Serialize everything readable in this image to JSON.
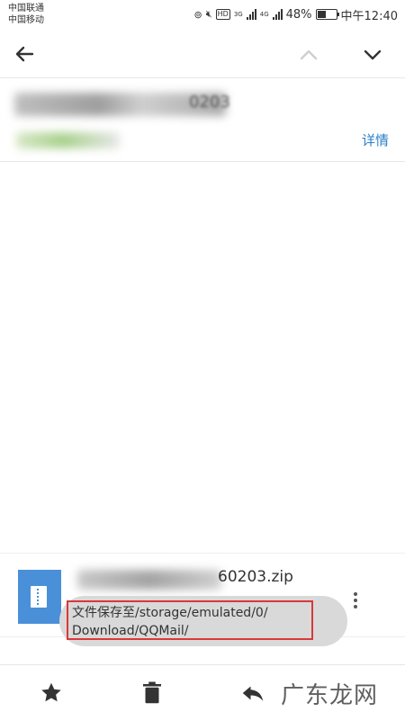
{
  "status_bar": {
    "carrier_1": "中国联通",
    "carrier_2": "中国移动",
    "hd_label": "HD",
    "net_1": "3G",
    "net_2": "4G",
    "battery": "48%",
    "battery_level": 0.48,
    "time": "中午12:40"
  },
  "mail": {
    "subject_tail": "0203",
    "details_link": "详情"
  },
  "attachment": {
    "filename_visible": "60203.zip",
    "icon": "zip-file-icon"
  },
  "toast": {
    "line1": "文件保存至/storage/emulated/0/",
    "line2": "Download/QQMail/"
  },
  "toolbar": {
    "star": "star-icon",
    "delete": "trash-icon",
    "reply": "reply-icon"
  },
  "watermark": "广东龙网",
  "colors": {
    "link": "#2a7fc7",
    "attachment_icon": "#4a90d9",
    "highlight_box": "#d9383a"
  }
}
